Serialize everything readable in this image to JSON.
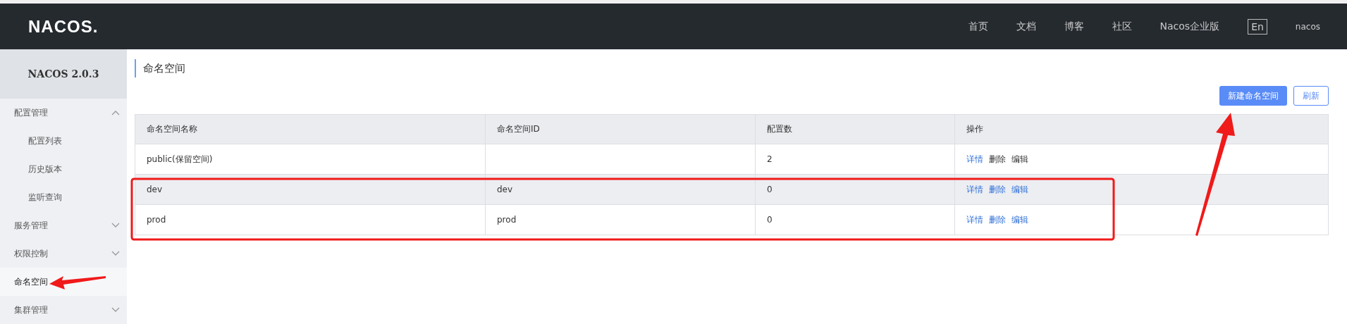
{
  "header": {
    "logo": "NACOS.",
    "nav": [
      "首页",
      "文档",
      "博客",
      "社区",
      "Nacos企业版"
    ],
    "language": "En",
    "user": "nacos"
  },
  "sidebar": {
    "title": "NACOS 2.0.3",
    "items": [
      {
        "label": "配置管理",
        "expanded": true,
        "selected": false,
        "children": [
          {
            "label": "配置列表",
            "selected": false
          },
          {
            "label": "历史版本",
            "selected": false
          },
          {
            "label": "监听查询",
            "selected": false
          }
        ]
      },
      {
        "label": "服务管理",
        "expanded": false,
        "selected": false
      },
      {
        "label": "权限控制",
        "expanded": false,
        "selected": false
      },
      {
        "label": "命名空间",
        "selected": true
      },
      {
        "label": "集群管理",
        "expanded": false,
        "selected": false
      }
    ]
  },
  "page": {
    "title": "命名空间",
    "buttons": [
      {
        "label": "新建命名空间",
        "kind": "primary"
      },
      {
        "label": "刷新",
        "kind": "secondary"
      }
    ]
  },
  "table": {
    "columns": [
      "命名空间名称",
      "命名空间ID",
      "配置数",
      "操作"
    ],
    "rows": [
      {
        "name": "public(保留空间)",
        "id": "",
        "count": "2",
        "hovered": false,
        "actions": [
          {
            "label": "详情",
            "disabled": false
          },
          {
            "label": "删除",
            "disabled": true
          },
          {
            "label": "编辑",
            "disabled": true
          }
        ]
      },
      {
        "name": "dev",
        "id": "dev",
        "count": "0",
        "hovered": true,
        "actions": [
          {
            "label": "详情",
            "disabled": false
          },
          {
            "label": "删除",
            "disabled": false
          },
          {
            "label": "编辑",
            "disabled": false
          }
        ]
      },
      {
        "name": "prod",
        "id": "prod",
        "count": "0",
        "hovered": false,
        "actions": [
          {
            "label": "详情",
            "disabled": false
          },
          {
            "label": "删除",
            "disabled": false
          },
          {
            "label": "编辑",
            "disabled": false
          }
        ]
      }
    ]
  }
}
